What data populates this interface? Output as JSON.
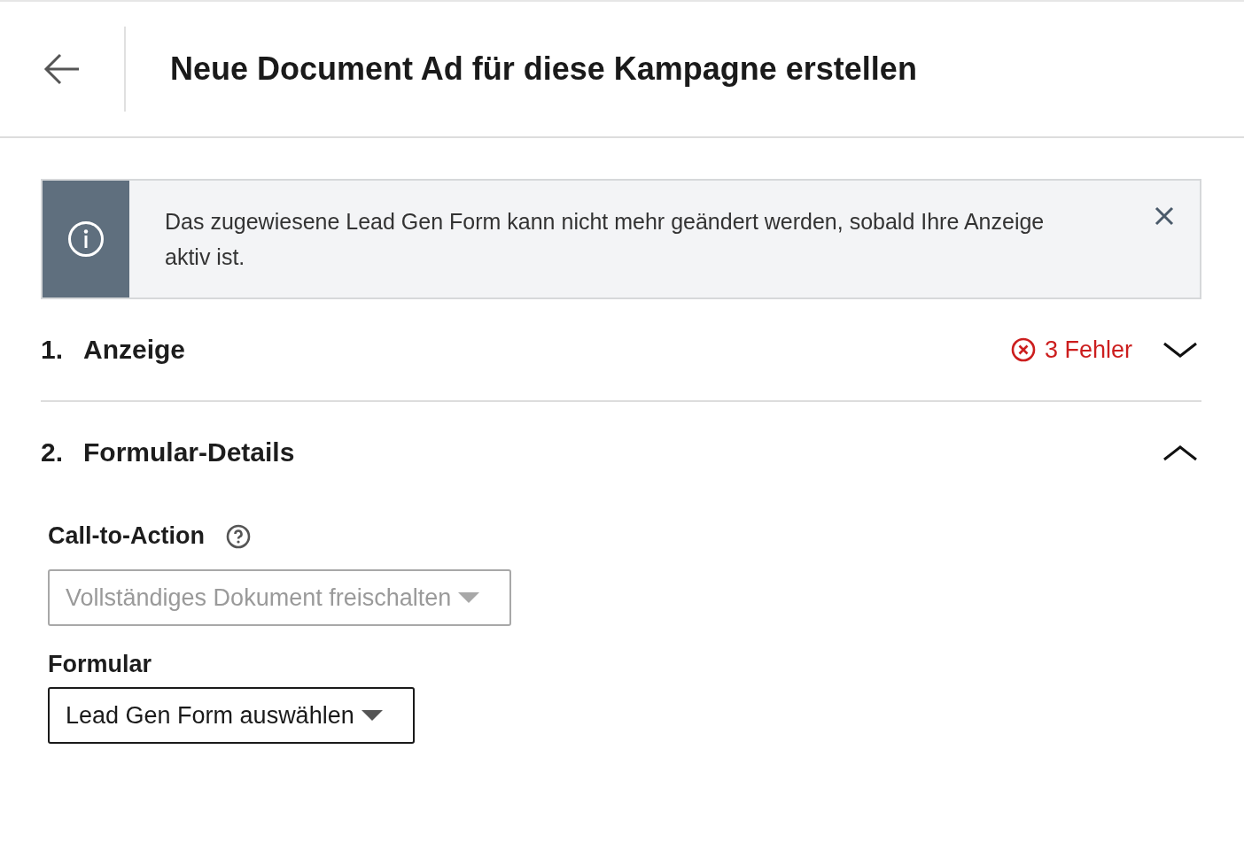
{
  "header": {
    "title": "Neue Document Ad für diese Kampagne erstellen"
  },
  "info_banner": {
    "message": "Das zugewiesene Lead Gen Form kann nicht mehr geändert werden, sobald Ihre Anzeige aktiv ist."
  },
  "sections": [
    {
      "number": "1.",
      "title": "Anzeige",
      "expanded": false,
      "error_count": "3 Fehler"
    },
    {
      "number": "2.",
      "title": "Formular-Details",
      "expanded": true,
      "fields": [
        {
          "label": "Call-to-Action",
          "help": true,
          "value": "Vollständiges Dokument freischalten",
          "disabled": true
        },
        {
          "label": "Formular",
          "help": false,
          "value": "Lead Gen Form auswählen",
          "disabled": false
        }
      ]
    }
  ]
}
